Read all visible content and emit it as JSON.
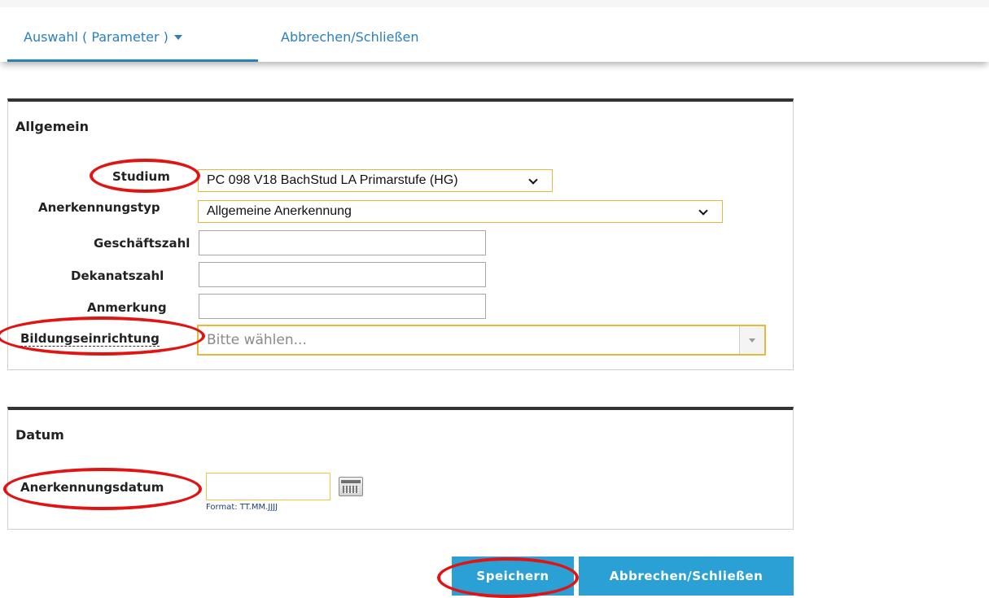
{
  "nav": {
    "tab_auswahl": "Auswahl ( Parameter )",
    "tab_abbrechen": "Abbrechen/Schließen"
  },
  "allgemein": {
    "title": "Allgemein",
    "studium_label": "Studium",
    "studium_value": "PC 098 V18 BachStud LA Primarstufe (HG)",
    "anerkennungstyp_label": "Anerkennungstyp",
    "anerkennungstyp_value": "Allgemeine Anerkennung",
    "geschaeftszahl_label": "Geschäftszahl",
    "geschaeftszahl_value": "",
    "dekanatszahl_label": "Dekanatszahl",
    "dekanatszahl_value": "",
    "anmerkung_label": "Anmerkung",
    "anmerkung_value": "",
    "bildung_label": "Bildungseinrichtung",
    "bildung_placeholder": "Bitte wählen..."
  },
  "datum": {
    "title": "Datum",
    "anerkennungsdatum_label": "Anerkennungsdatum",
    "anerkennungsdatum_value": "",
    "format_hint": "Format: TT.MM.JJJJ"
  },
  "buttons": {
    "save": "Speichern",
    "cancel": "Abbrechen/Schließen"
  },
  "colors": {
    "accent": "#2a80b9",
    "button": "#2aa0d4",
    "highlight_border": "#e5b93a",
    "annotation_red": "#e11414"
  },
  "icons": [
    "caret-down-icon",
    "chevron-down-icon",
    "calendar-icon"
  ]
}
